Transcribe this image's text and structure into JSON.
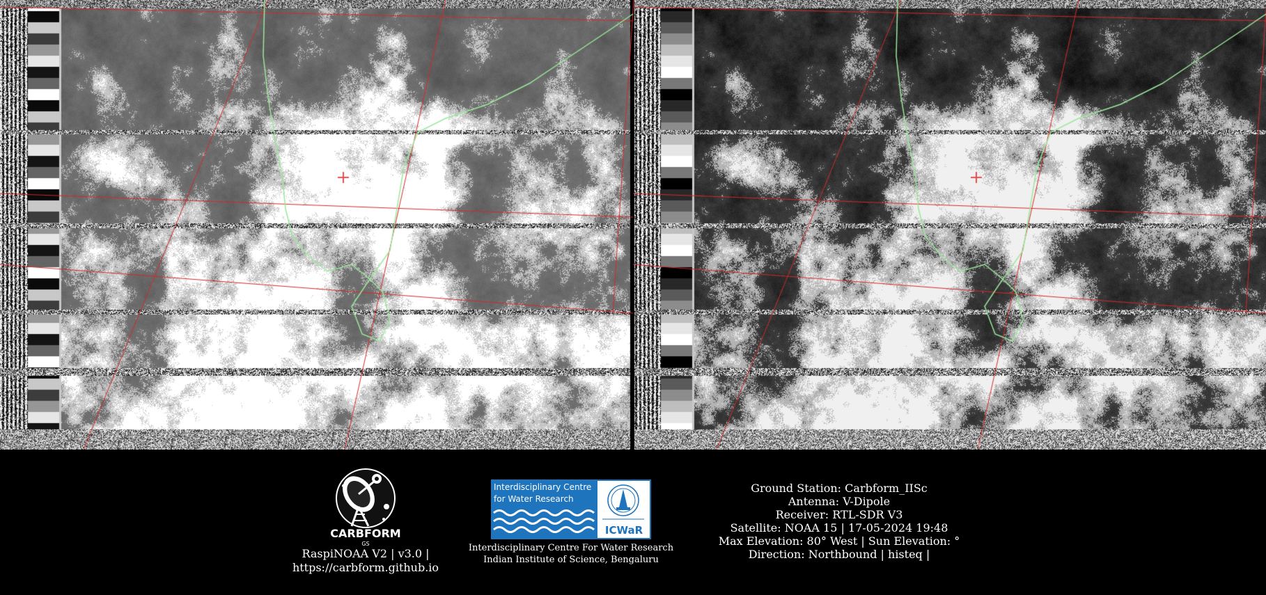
{
  "overlay_colors": {
    "grid": "#d22a2a",
    "coastline": "#9be89b",
    "station_marker": "#e05050"
  },
  "imagery": {
    "channels": [
      "visible",
      "infrared"
    ]
  },
  "carbform": {
    "logo_text": "CARBFORM",
    "logo_subtext": "GS",
    "line1": "RaspiNOAA V2 | v3.0 |",
    "line2": "https://carbform.github.io"
  },
  "icwar": {
    "logo_title_line1": "Interdisciplinary Centre",
    "logo_title_line2": "for Water Research",
    "logo_acronym": "ICWaR",
    "line1": "Interdisciplinary Centre For Water Research",
    "line2": "Indian Institute of Science, Bengaluru"
  },
  "station": {
    "ground_station": "Ground Station: Carbform_IISc",
    "antenna": "Antenna: V-Dipole",
    "receiver": "Receiver: RTL-SDR V3",
    "satellite": "Satellite: NOAA 15 | 17-05-2024 19:48",
    "elevation": "Max Elevation: 80° West | Sun Elevation: °",
    "direction": "Direction: Northbound | histeq |"
  }
}
